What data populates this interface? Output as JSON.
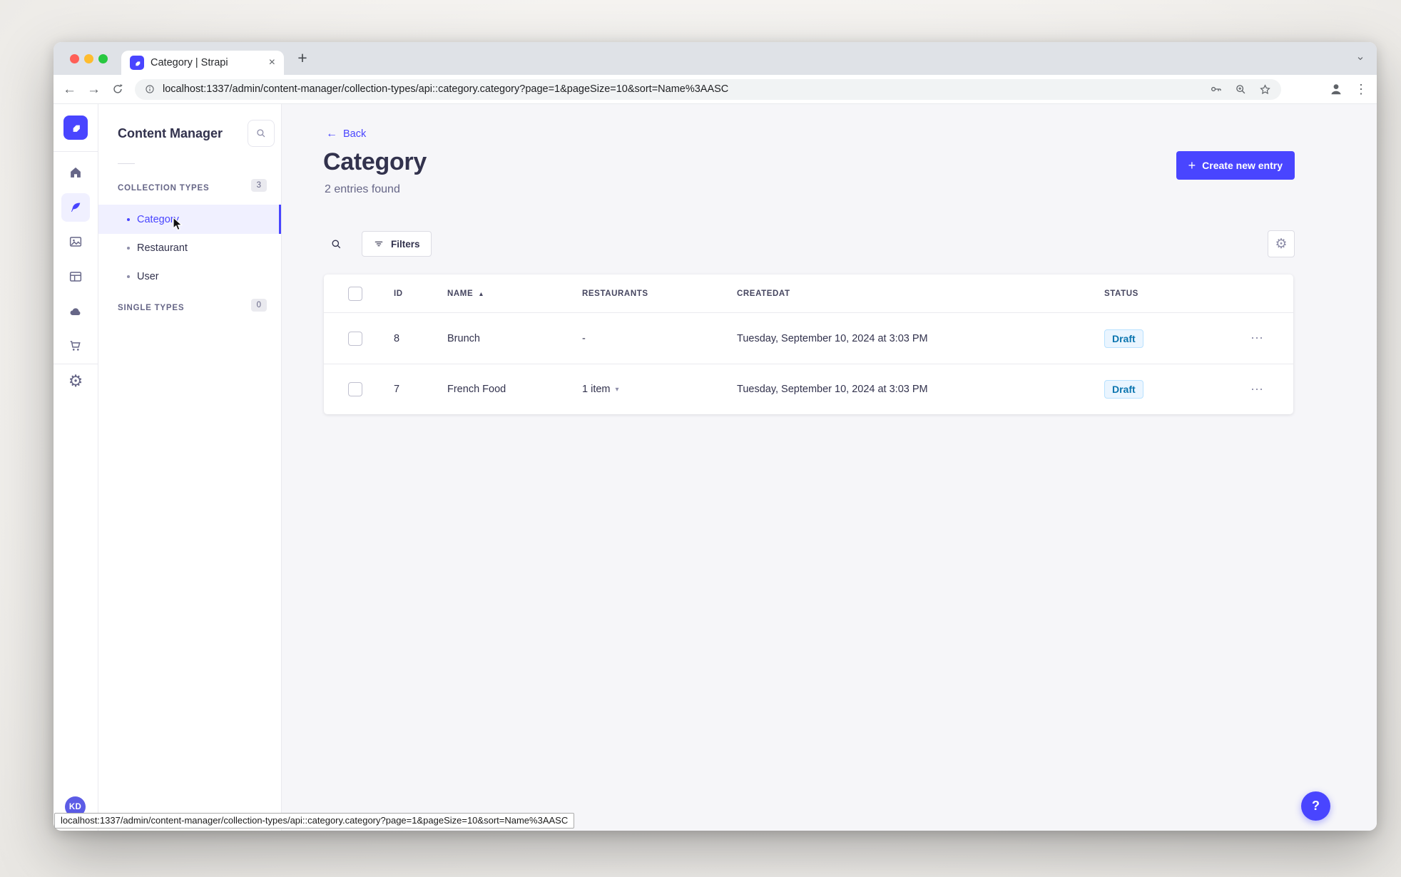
{
  "colors": {
    "accent": "#4945ff",
    "draft_bg": "#eaf5ff",
    "draft_text": "#0c75af"
  },
  "browser": {
    "tab_title": "Category | Strapi",
    "url": "localhost:1337/admin/content-manager/collection-types/api::category.category?page=1&pageSize=10&sort=Name%3AASC",
    "status_url": "localhost:1337/admin/content-manager/collection-types/api::category.category?page=1&pageSize=10&sort=Name%3AASC"
  },
  "icons": {
    "back_arrow": "←",
    "forward_arrow": "→",
    "plus": "+",
    "tab_close": "×",
    "menu_dots": "⋮",
    "row_menu": "⋯",
    "sort_asc": "▲",
    "chevron_small": "▾",
    "gear": "⚙",
    "help": "?"
  },
  "nav": {
    "title": "Content Manager",
    "collection_types_label": "COLLECTION TYPES",
    "collection_types_count": "3",
    "items": [
      {
        "label": "Category"
      },
      {
        "label": "Restaurant"
      },
      {
        "label": "User"
      }
    ],
    "single_types_label": "SINGLE TYPES",
    "single_types_count": "0"
  },
  "header": {
    "back_label": "Back",
    "title": "Category",
    "subtitle": "2 entries found",
    "create_button_label": "Create new entry"
  },
  "toolbar": {
    "filters_label": "Filters"
  },
  "table": {
    "headers": {
      "id": "ID",
      "name": "NAME",
      "restaurants": "RESTAURANTS",
      "createdat": "CREATEDAT",
      "status": "STATUS"
    },
    "rows": [
      {
        "id": "8",
        "name": "Brunch",
        "restaurants": "-",
        "createdat": "Tuesday, September 10, 2024 at 3:03 PM",
        "status": "Draft"
      },
      {
        "id": "7",
        "name": "French Food",
        "restaurants": "1 item",
        "createdat": "Tuesday, September 10, 2024 at 3:03 PM",
        "status": "Draft"
      }
    ]
  },
  "user": {
    "initials": "KD"
  }
}
